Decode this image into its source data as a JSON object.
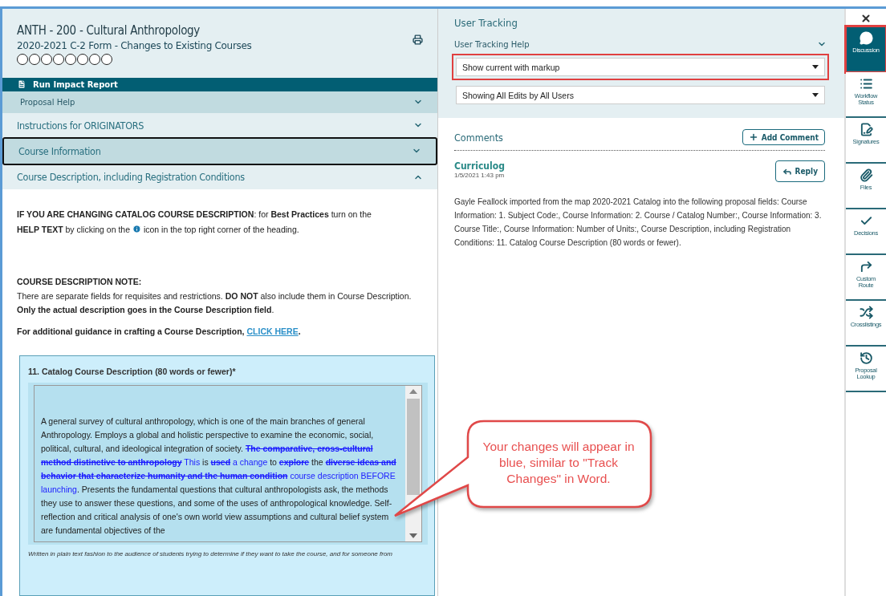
{
  "course": {
    "title": "ANTH - 200 - Cultural Anthropology",
    "form": "2020-2021 C-2 Form - Changes to Existing Courses",
    "steps": [
      {
        "completed": false
      },
      {
        "completed": false
      },
      {
        "completed": false
      },
      {
        "completed": false
      },
      {
        "completed": false
      },
      {
        "completed": false
      },
      {
        "completed": false
      },
      {
        "completed": false
      }
    ]
  },
  "impact_report": {
    "label": "Run Impact Report"
  },
  "proposal_help": {
    "label": "Proposal Help",
    "expanded": false
  },
  "sections": [
    {
      "title": "Instructions for ORIGINATORS",
      "expanded": false,
      "focused": false
    },
    {
      "title": "Course Information",
      "expanded": false,
      "focused": true
    },
    {
      "title": "Course Description, including Registration Conditions",
      "expanded": true,
      "focused": false
    }
  ],
  "instructions": {
    "intro_line": "**IF YOU ARE CHANGING CATALOG COURSE DESCRIPTION**: for **Best Practices** turn on the",
    "intro_before_icon": "**HELP TEXT** by clicking on the",
    "intro_after_icon": "icon in the top right corner of the heading.",
    "note_heading": "COURSE DESCRIPTION NOTE:",
    "note": "There are separate fields for requisites and restrictions. **DO NOT** also include them in Course Description. **Only the actual description goes in the Course Description field**.",
    "guidance": "For additional guidance in crafting a Course Description,",
    "guidance_link": "CLICK HERE",
    "guidance_end": "."
  },
  "field": {
    "label": "11. Catalog Course Description (80 words or fewer)*",
    "segments": [
      {
        "kind": "plain",
        "text": "A general survey of cultural anthropology, which is one of the main branches of general Anthropology. Employs a global and holistic perspective to examine the economic, social, political, cultural, and ideological integration of society. "
      },
      {
        "kind": "deleted",
        "text": "The comparative, cross-cultural method distinctive to anthropology"
      },
      {
        "kind": "inserted",
        "text": " This"
      },
      {
        "kind": "plain",
        "text": " is "
      },
      {
        "kind": "deleted",
        "text": "used"
      },
      {
        "kind": "inserted",
        "text": " a change"
      },
      {
        "kind": "plain",
        "text": " to "
      },
      {
        "kind": "deleted",
        "text": "explore"
      },
      {
        "kind": "plain",
        "text": " the "
      },
      {
        "kind": "deleted",
        "text": "diverse ideas and behavior that characterize humanity and the human condition"
      },
      {
        "kind": "inserted",
        "text": " course description BEFORE launching"
      },
      {
        "kind": "plain",
        "text": ". Presents the fundamental questions that cultural anthropologists ask, the methods they use to answer these questions, and some of the uses of anthropological knowledge. Self-reflection and critical analysis of one's own world view assumptions and cultural belief system are fundamental objectives of the"
      }
    ],
    "hint": "Written in plain text fashion to the audience of students trying to determine if they want to take the course, and for someone from"
  },
  "tracking": {
    "title": "User Tracking",
    "help": "User Tracking Help",
    "selects": [
      {
        "value": "Show current with markup",
        "highlighted": true
      },
      {
        "value": "Showing All Edits by All Users",
        "highlighted": false
      }
    ]
  },
  "comments": {
    "title": "Comments",
    "add_button": "Add Comment",
    "items": [
      {
        "author": "Curriculog",
        "date": "1/5/2021 1:43 pm",
        "reply": "Reply",
        "body": "Gayle Feallock imported from the map 2020-2021 Catalog into the following proposal fields: Course Information: 1. Subject Code:, Course Information: 2. Course / Catalog Number:, Course Information: 3. Course Title:, Course Information: Number of Units:, Course Description, including Registration Conditions: 11. Catalog Course Description (80 words or fewer)."
      }
    ]
  },
  "sidebar": {
    "items": [
      {
        "kind": "discussion",
        "label": "Discussion",
        "selected": true,
        "highlighted": true
      },
      {
        "kind": "workflow",
        "label": "Workflow Status",
        "selected": false,
        "highlighted": false
      },
      {
        "kind": "signatures",
        "label": "Signatures",
        "selected": false,
        "highlighted": false
      },
      {
        "kind": "files",
        "label": "Files",
        "selected": false,
        "highlighted": false
      },
      {
        "kind": "decisions",
        "label": "Decisions",
        "selected": false,
        "highlighted": false
      },
      {
        "kind": "route",
        "label": "Custom Route",
        "selected": false,
        "highlighted": false
      },
      {
        "kind": "crosslistings",
        "label": "Crosslistings",
        "selected": false,
        "highlighted": false
      },
      {
        "kind": "lookup",
        "label": "Proposal Lookup",
        "selected": false,
        "highlighted": false
      }
    ]
  },
  "callout": {
    "text": "Your changes will appear in blue, similar to \"Track Changes\" in Word."
  }
}
